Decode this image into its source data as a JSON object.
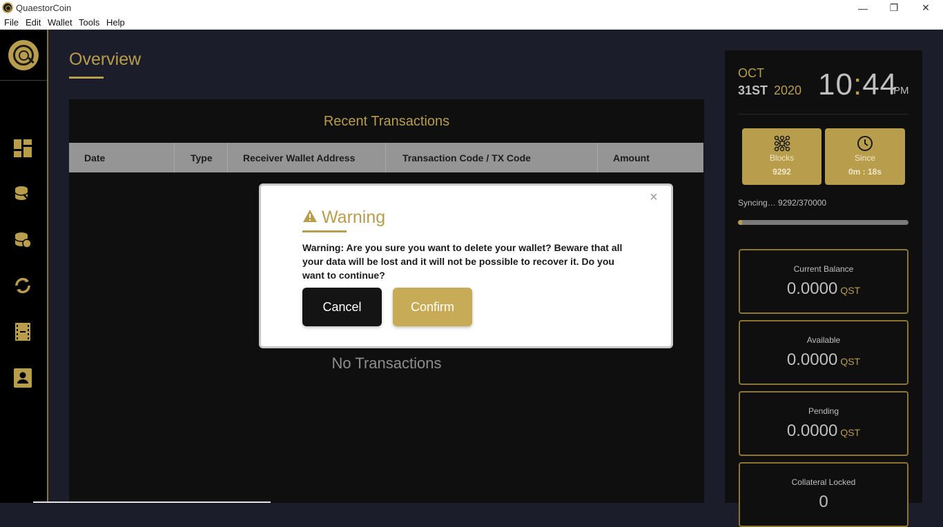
{
  "window": {
    "title": "QuaestorCoin",
    "minimize_label": "—",
    "maximize_label": "❐",
    "close_label": "✕"
  },
  "menu": [
    "File",
    "Edit",
    "Wallet",
    "Tools",
    "Help"
  ],
  "sidebar": {
    "items": [
      {
        "name": "dashboard",
        "icon": "dashboard-icon"
      },
      {
        "name": "send",
        "icon": "coin-send-icon"
      },
      {
        "name": "receive",
        "icon": "coin-receive-icon"
      },
      {
        "name": "transactions",
        "icon": "sync-icon"
      },
      {
        "name": "address-book",
        "icon": "film-icon"
      },
      {
        "name": "contacts",
        "icon": "contact-icon"
      }
    ]
  },
  "overview": {
    "title": "Overview",
    "recent_transactions_title": "Recent Transactions",
    "columns": [
      "Date",
      "Type",
      "Receiver Wallet Address",
      "Transaction Code / TX Code",
      "Amount"
    ],
    "empty_text": "No Transactions"
  },
  "clock": {
    "month": "OCT",
    "day": "31ST",
    "year": "2020",
    "hour": "10",
    "colon": ":",
    "minute": "44",
    "ampm": "PM"
  },
  "stats": {
    "blocks_label": "Blocks",
    "blocks_value": "9292",
    "since_label": "Since",
    "since_value": "0m : 18s"
  },
  "sync": {
    "text": "Syncing…  9292/370000",
    "progress_fraction": 0.025
  },
  "balances": [
    {
      "label": "Current Balance",
      "amount": "0.0000",
      "unit": "QST"
    },
    {
      "label": "Available",
      "amount": "0.0000",
      "unit": "QST"
    },
    {
      "label": "Pending",
      "amount": "0.0000",
      "unit": "QST"
    },
    {
      "label": "Collateral Locked",
      "amount": "0",
      "unit": ""
    }
  ],
  "modal": {
    "title": "Warning",
    "close_label": "×",
    "message": "Warning: Are you sure you want to delete your wallet? Beware that all your data will be lost and it will not be possible to recover it. Do you want to continue?",
    "cancel_label": "Cancel",
    "confirm_label": "Confirm"
  },
  "colors": {
    "accent_gold": "#b89d4d",
    "background": "#1c1d2b",
    "panel": "#0f0f10"
  }
}
